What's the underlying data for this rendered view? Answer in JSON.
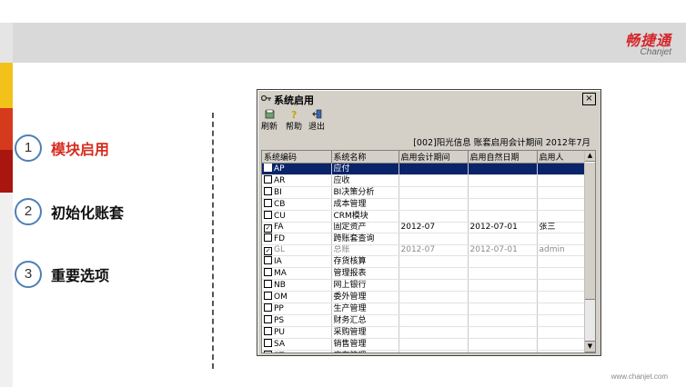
{
  "brand": {
    "name_cn": "畅捷通",
    "name_en": "Chanjet"
  },
  "footer": {
    "url": "www.chanjet.com"
  },
  "nav": [
    {
      "num": "1",
      "label": "模块启用",
      "active": true
    },
    {
      "num": "2",
      "label": "初始化账套",
      "active": false
    },
    {
      "num": "3",
      "label": "重要选项",
      "active": false
    }
  ],
  "window": {
    "title": "系统启用",
    "close_glyph": "×",
    "toolbar": [
      {
        "label": "刷新",
        "icon": "refresh-icon"
      },
      {
        "label": "帮助",
        "icon": "help-icon"
      },
      {
        "label": "退出",
        "icon": "exit-icon"
      }
    ],
    "headline": "[002]阳光信息 账套启用会计期间 2012年7月",
    "columns": [
      "系统编码",
      "系统名称",
      "启用会计期间",
      "启用自然日期",
      "启用人"
    ],
    "rows": [
      {
        "code": "AP",
        "name": "应付",
        "period": "",
        "date": "",
        "user": "",
        "checked": false,
        "selected": true,
        "disabled": false
      },
      {
        "code": "AR",
        "name": "应收",
        "period": "",
        "date": "",
        "user": "",
        "checked": false,
        "selected": false,
        "disabled": false
      },
      {
        "code": "BI",
        "name": "BI决策分析",
        "period": "",
        "date": "",
        "user": "",
        "checked": false,
        "selected": false,
        "disabled": false
      },
      {
        "code": "CB",
        "name": "成本管理",
        "period": "",
        "date": "",
        "user": "",
        "checked": false,
        "selected": false,
        "disabled": false
      },
      {
        "code": "CU",
        "name": "CRM模块",
        "period": "",
        "date": "",
        "user": "",
        "checked": false,
        "selected": false,
        "disabled": false
      },
      {
        "code": "FA",
        "name": "固定资产",
        "period": "2012-07",
        "date": "2012-07-01",
        "user": "张三",
        "checked": true,
        "selected": false,
        "disabled": false
      },
      {
        "code": "FD",
        "name": "跨账套查询",
        "period": "",
        "date": "",
        "user": "",
        "checked": false,
        "selected": false,
        "disabled": false
      },
      {
        "code": "GL",
        "name": "总账",
        "period": "2012-07",
        "date": "2012-07-01",
        "user": "admin",
        "checked": true,
        "selected": false,
        "disabled": true
      },
      {
        "code": "IA",
        "name": "存货核算",
        "period": "",
        "date": "",
        "user": "",
        "checked": false,
        "selected": false,
        "disabled": false
      },
      {
        "code": "MA",
        "name": "管理报表",
        "period": "",
        "date": "",
        "user": "",
        "checked": false,
        "selected": false,
        "disabled": false
      },
      {
        "code": "NB",
        "name": "网上银行",
        "period": "",
        "date": "",
        "user": "",
        "checked": false,
        "selected": false,
        "disabled": false
      },
      {
        "code": "OM",
        "name": "委外管理",
        "period": "",
        "date": "",
        "user": "",
        "checked": false,
        "selected": false,
        "disabled": false
      },
      {
        "code": "PP",
        "name": "生产管理",
        "period": "",
        "date": "",
        "user": "",
        "checked": false,
        "selected": false,
        "disabled": false
      },
      {
        "code": "PS",
        "name": "财务汇总",
        "period": "",
        "date": "",
        "user": "",
        "checked": false,
        "selected": false,
        "disabled": false
      },
      {
        "code": "PU",
        "name": "采购管理",
        "period": "",
        "date": "",
        "user": "",
        "checked": false,
        "selected": false,
        "disabled": false
      },
      {
        "code": "SA",
        "name": "销售管理",
        "period": "",
        "date": "",
        "user": "",
        "checked": false,
        "selected": false,
        "disabled": false
      },
      {
        "code": "ST",
        "name": "库存管理",
        "period": "",
        "date": "",
        "user": "",
        "checked": false,
        "selected": false,
        "disabled": false
      }
    ]
  },
  "colors": {
    "accent_red": "#d62c1f",
    "selection": "#0a246a",
    "circle_border": "#4f7fb6"
  }
}
